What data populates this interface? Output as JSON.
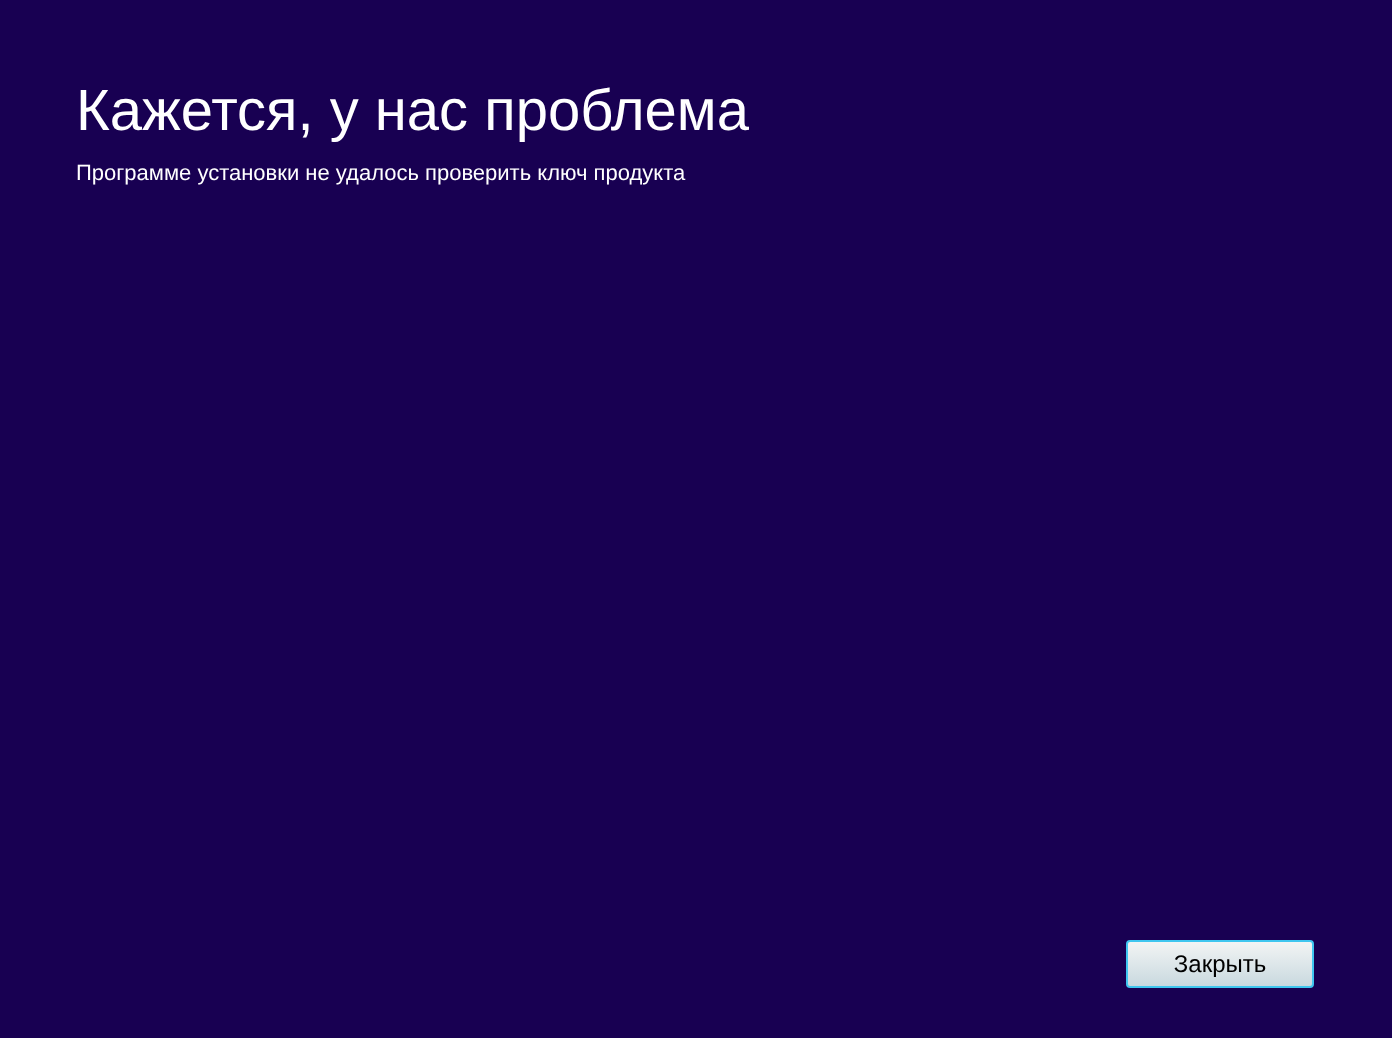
{
  "title": "Кажется, у нас проблема",
  "message": "Программе установки не удалось проверить ключ продукта",
  "buttons": [
    {
      "label": "Закрыть"
    }
  ]
}
